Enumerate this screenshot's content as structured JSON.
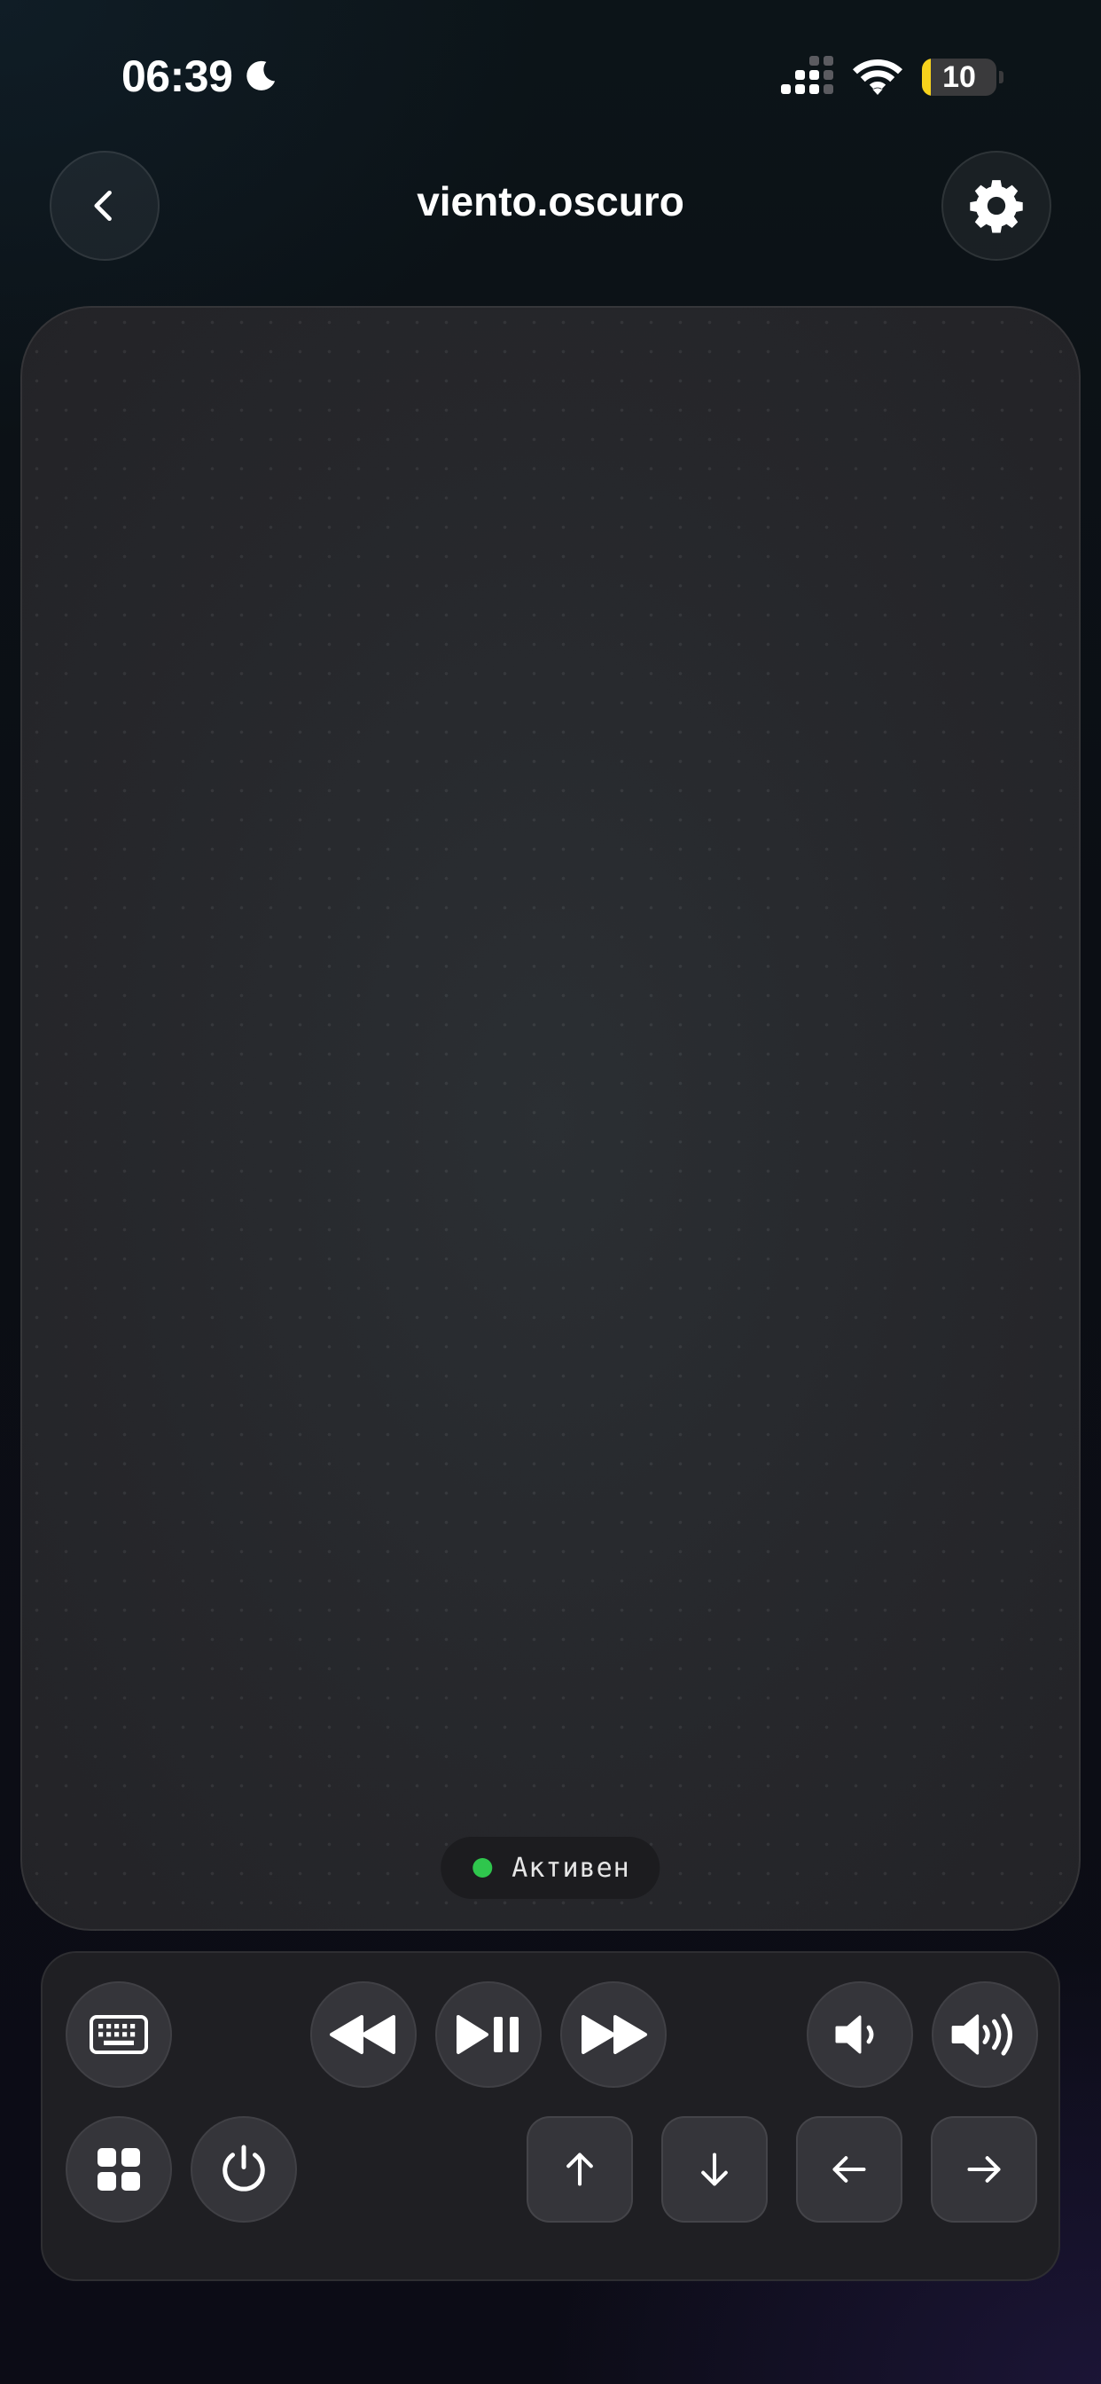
{
  "status_bar": {
    "time": "06:39",
    "battery_level": "10",
    "icons": [
      "moon-icon",
      "cellular-signal-icon",
      "wifi-icon",
      "battery-icon"
    ]
  },
  "header": {
    "title": "viento.oscuro",
    "back_icon": "chevron-left-icon",
    "settings_icon": "gear-icon"
  },
  "touchpad": {
    "status_text": "Активен",
    "status_color": "#2fc64d"
  },
  "controls": {
    "row1": [
      "keyboard-icon",
      "rewind-icon",
      "play-pause-icon",
      "fast-forward-icon",
      "volume-down-icon",
      "volume-up-icon"
    ],
    "row2": [
      "apps-grid-icon",
      "power-icon",
      "arrow-up-icon",
      "arrow-down-icon",
      "arrow-left-icon",
      "arrow-right-icon"
    ]
  },
  "colors": {
    "accent_green": "#2fc64d",
    "battery_yellow": "#f7d21c",
    "button_bg": "#35353a",
    "panel_bg": "#1f1f23"
  }
}
